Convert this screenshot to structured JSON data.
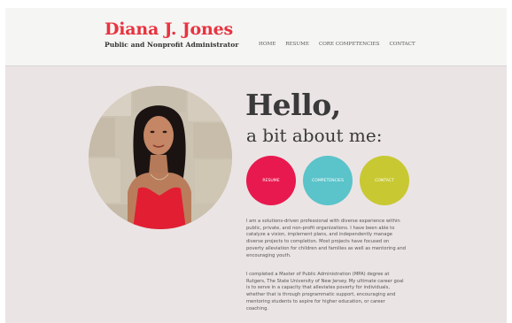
{
  "site": {
    "name": "Diana J. Jones",
    "subtitle": "Public and Nonprofit Administrator"
  },
  "nav": {
    "items": [
      "HOME",
      "RESUME",
      "CORE COMPETENCIES",
      "CONTACT"
    ]
  },
  "hero": {
    "greeting": "Hello,",
    "subheading": "a bit about me:"
  },
  "buttons": {
    "resume": "RESUME",
    "competencies": "COMPETENCIES",
    "contact": "CONTACT"
  },
  "bio": {
    "paragraph1": "I am a solutions-driven professional with diverse experience within public, private, and non-profit organizations. I have been able to catalyze a vision, implement plans, and independently manage diverse projects to completion. Most projects have focused on poverty alleviation for children and families as well as mentoring and encouraging youth.",
    "paragraph2": "I completed a Master of Public Administration (MPA) degree at Rutgers, The State University of New Jersey. My ultimate career goal is to serve in a capacity that alleviates poverty for individuals, whether that is through programmatic support, encouraging and mentoring students to aspire for higher education, or career coaching."
  },
  "colors": {
    "brand_red": "#e8333f",
    "resume_btn": "#e8194f",
    "competencies_btn": "#5bc3ca",
    "contact_btn": "#c8c832",
    "page_bg": "#ebe4e4",
    "header_bg": "#f5f5f3"
  },
  "images": {
    "profile_photo": "portrait of a woman in a red sleeveless top"
  }
}
